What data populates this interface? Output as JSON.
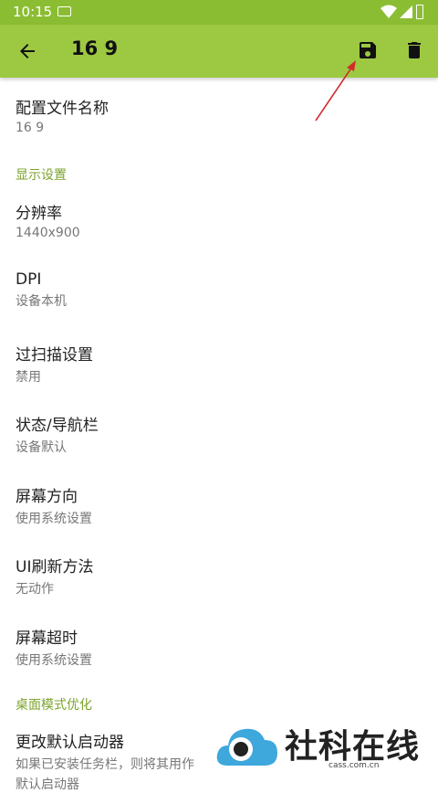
{
  "status_bar": {
    "time": "10:15",
    "icons": [
      "notification-icon",
      "wifi-icon",
      "signal-icon",
      "battery-icon"
    ]
  },
  "appbar": {
    "title": "16 9",
    "background": "#9dc942",
    "back_icon": "arrow-back-icon",
    "save_icon": "save-icon",
    "delete_icon": "delete-icon"
  },
  "profile": {
    "label": "配置文件名称",
    "value": "16 9"
  },
  "sections": {
    "display": "显示设置",
    "desktop": "桌面模式优化"
  },
  "settings": [
    {
      "label": "分辨率",
      "value": "1440x900"
    },
    {
      "label": "DPI",
      "value": "设备本机"
    },
    {
      "label": "过扫描设置",
      "value": "禁用"
    },
    {
      "label": "状态/导航栏",
      "value": "设备默认"
    },
    {
      "label": "屏幕方向",
      "value": "使用系统设置"
    },
    {
      "label": "UI刷新方法",
      "value": "无动作"
    },
    {
      "label": "屏幕超时",
      "value": "使用系统设置"
    }
  ],
  "launcher": {
    "label": "更改默认启动器",
    "value": "如果已安装任务栏，则将其用作",
    "value2": "默认启动器"
  },
  "watermark": {
    "text": "社科在线",
    "sub": "cass.com.cn"
  },
  "colors": {
    "accent": "#9dc942",
    "section": "#7ca32c",
    "annotation_arrow": "#d22b2b"
  }
}
